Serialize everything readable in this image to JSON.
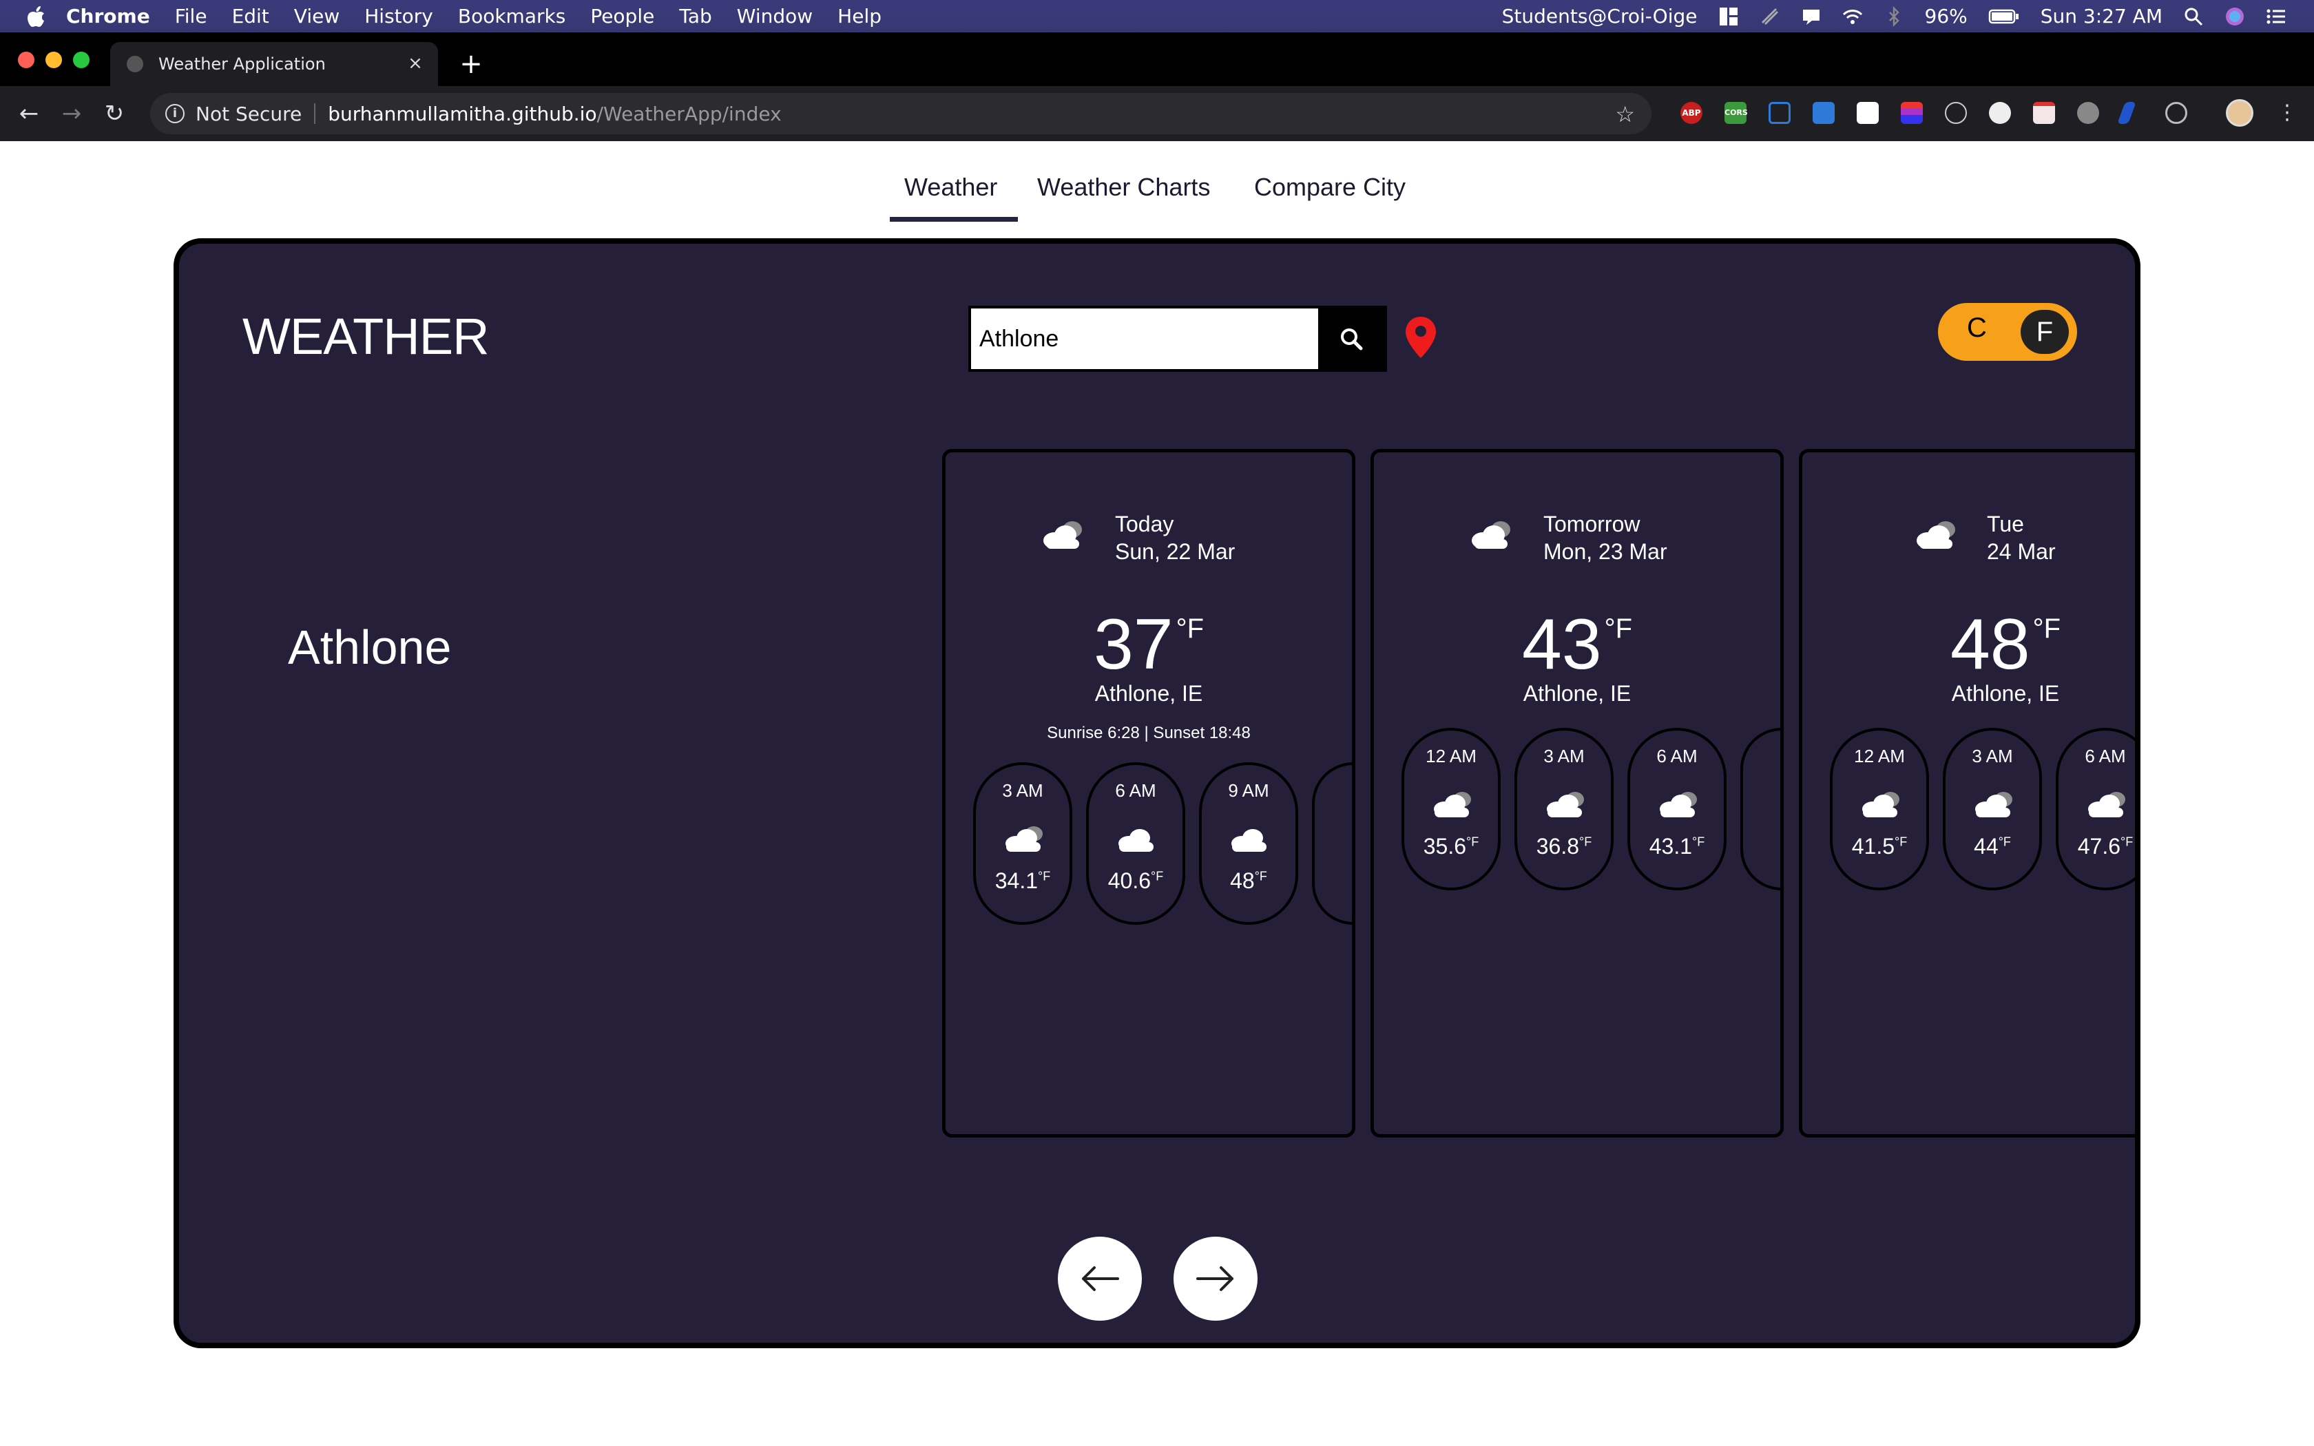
{
  "menubar": {
    "app": "Chrome",
    "items": [
      "File",
      "Edit",
      "View",
      "History",
      "Bookmarks",
      "People",
      "Tab",
      "Window",
      "Help"
    ],
    "user": "Students@Croi-Oige",
    "battery": "96%",
    "clock": "Sun 3:27 AM"
  },
  "browser": {
    "tab_title": "Weather Application",
    "not_secure": "Not Secure",
    "url_host": "burhanmullamitha.github.io",
    "url_path": "/WeatherApp/index",
    "extensions": [
      "ABP",
      "CORS"
    ]
  },
  "nav": {
    "tabs": [
      "Weather",
      "Weather Charts",
      "Compare City"
    ],
    "active": "Weather"
  },
  "app": {
    "brand": "WEATHER",
    "search_value": "Athlone",
    "unit_c": "C",
    "unit_f": "F",
    "selected_unit": "F",
    "city": "Athlone",
    "accent": "#f7a01a",
    "background": "#251f3a"
  },
  "days": [
    {
      "day_label": "Today",
      "date": "Sun, 22 Mar",
      "temp": "37",
      "unit": "°F",
      "location": "Athlone, IE",
      "sun": "Sunrise 6:28 | Sunset 18:48",
      "hours": [
        {
          "time": "3 AM",
          "temp": "34.1",
          "unit": "°F"
        },
        {
          "time": "6 AM",
          "temp": "40.6",
          "unit": "°F"
        },
        {
          "time": "9 AM",
          "temp": "48",
          "unit": "°F"
        }
      ]
    },
    {
      "day_label": "Tomorrow",
      "date": "Mon, 23 Mar",
      "temp": "43",
      "unit": "°F",
      "location": "Athlone, IE",
      "hours": [
        {
          "time": "12 AM",
          "temp": "35.6",
          "unit": "°F"
        },
        {
          "time": "3 AM",
          "temp": "36.8",
          "unit": "°F"
        },
        {
          "time": "6 AM",
          "temp": "43.1",
          "unit": "°F"
        }
      ]
    },
    {
      "day_label": "Tue",
      "date": "24 Mar",
      "temp": "48",
      "unit": "°F",
      "location": "Athlone, IE",
      "hours": [
        {
          "time": "12 AM",
          "temp": "41.5",
          "unit": "°F"
        },
        {
          "time": "3 AM",
          "temp": "44",
          "unit": "°F"
        },
        {
          "time": "6 AM",
          "temp": "47.6",
          "unit": "°F"
        }
      ]
    }
  ]
}
